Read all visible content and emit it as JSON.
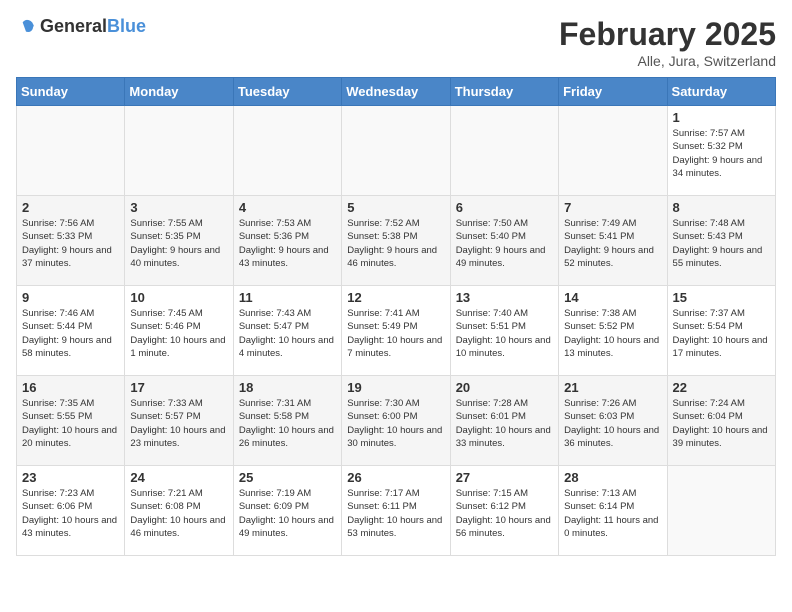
{
  "header": {
    "logo_general": "General",
    "logo_blue": "Blue",
    "title": "February 2025",
    "subtitle": "Alle, Jura, Switzerland"
  },
  "days_of_week": [
    "Sunday",
    "Monday",
    "Tuesday",
    "Wednesday",
    "Thursday",
    "Friday",
    "Saturday"
  ],
  "weeks": [
    [
      {
        "day": "",
        "info": ""
      },
      {
        "day": "",
        "info": ""
      },
      {
        "day": "",
        "info": ""
      },
      {
        "day": "",
        "info": ""
      },
      {
        "day": "",
        "info": ""
      },
      {
        "day": "",
        "info": ""
      },
      {
        "day": "1",
        "info": "Sunrise: 7:57 AM\nSunset: 5:32 PM\nDaylight: 9 hours and 34 minutes."
      }
    ],
    [
      {
        "day": "2",
        "info": "Sunrise: 7:56 AM\nSunset: 5:33 PM\nDaylight: 9 hours and 37 minutes."
      },
      {
        "day": "3",
        "info": "Sunrise: 7:55 AM\nSunset: 5:35 PM\nDaylight: 9 hours and 40 minutes."
      },
      {
        "day": "4",
        "info": "Sunrise: 7:53 AM\nSunset: 5:36 PM\nDaylight: 9 hours and 43 minutes."
      },
      {
        "day": "5",
        "info": "Sunrise: 7:52 AM\nSunset: 5:38 PM\nDaylight: 9 hours and 46 minutes."
      },
      {
        "day": "6",
        "info": "Sunrise: 7:50 AM\nSunset: 5:40 PM\nDaylight: 9 hours and 49 minutes."
      },
      {
        "day": "7",
        "info": "Sunrise: 7:49 AM\nSunset: 5:41 PM\nDaylight: 9 hours and 52 minutes."
      },
      {
        "day": "8",
        "info": "Sunrise: 7:48 AM\nSunset: 5:43 PM\nDaylight: 9 hours and 55 minutes."
      }
    ],
    [
      {
        "day": "9",
        "info": "Sunrise: 7:46 AM\nSunset: 5:44 PM\nDaylight: 9 hours and 58 minutes."
      },
      {
        "day": "10",
        "info": "Sunrise: 7:45 AM\nSunset: 5:46 PM\nDaylight: 10 hours and 1 minute."
      },
      {
        "day": "11",
        "info": "Sunrise: 7:43 AM\nSunset: 5:47 PM\nDaylight: 10 hours and 4 minutes."
      },
      {
        "day": "12",
        "info": "Sunrise: 7:41 AM\nSunset: 5:49 PM\nDaylight: 10 hours and 7 minutes."
      },
      {
        "day": "13",
        "info": "Sunrise: 7:40 AM\nSunset: 5:51 PM\nDaylight: 10 hours and 10 minutes."
      },
      {
        "day": "14",
        "info": "Sunrise: 7:38 AM\nSunset: 5:52 PM\nDaylight: 10 hours and 13 minutes."
      },
      {
        "day": "15",
        "info": "Sunrise: 7:37 AM\nSunset: 5:54 PM\nDaylight: 10 hours and 17 minutes."
      }
    ],
    [
      {
        "day": "16",
        "info": "Sunrise: 7:35 AM\nSunset: 5:55 PM\nDaylight: 10 hours and 20 minutes."
      },
      {
        "day": "17",
        "info": "Sunrise: 7:33 AM\nSunset: 5:57 PM\nDaylight: 10 hours and 23 minutes."
      },
      {
        "day": "18",
        "info": "Sunrise: 7:31 AM\nSunset: 5:58 PM\nDaylight: 10 hours and 26 minutes."
      },
      {
        "day": "19",
        "info": "Sunrise: 7:30 AM\nSunset: 6:00 PM\nDaylight: 10 hours and 30 minutes."
      },
      {
        "day": "20",
        "info": "Sunrise: 7:28 AM\nSunset: 6:01 PM\nDaylight: 10 hours and 33 minutes."
      },
      {
        "day": "21",
        "info": "Sunrise: 7:26 AM\nSunset: 6:03 PM\nDaylight: 10 hours and 36 minutes."
      },
      {
        "day": "22",
        "info": "Sunrise: 7:24 AM\nSunset: 6:04 PM\nDaylight: 10 hours and 39 minutes."
      }
    ],
    [
      {
        "day": "23",
        "info": "Sunrise: 7:23 AM\nSunset: 6:06 PM\nDaylight: 10 hours and 43 minutes."
      },
      {
        "day": "24",
        "info": "Sunrise: 7:21 AM\nSunset: 6:08 PM\nDaylight: 10 hours and 46 minutes."
      },
      {
        "day": "25",
        "info": "Sunrise: 7:19 AM\nSunset: 6:09 PM\nDaylight: 10 hours and 49 minutes."
      },
      {
        "day": "26",
        "info": "Sunrise: 7:17 AM\nSunset: 6:11 PM\nDaylight: 10 hours and 53 minutes."
      },
      {
        "day": "27",
        "info": "Sunrise: 7:15 AM\nSunset: 6:12 PM\nDaylight: 10 hours and 56 minutes."
      },
      {
        "day": "28",
        "info": "Sunrise: 7:13 AM\nSunset: 6:14 PM\nDaylight: 11 hours and 0 minutes."
      },
      {
        "day": "",
        "info": ""
      }
    ]
  ]
}
